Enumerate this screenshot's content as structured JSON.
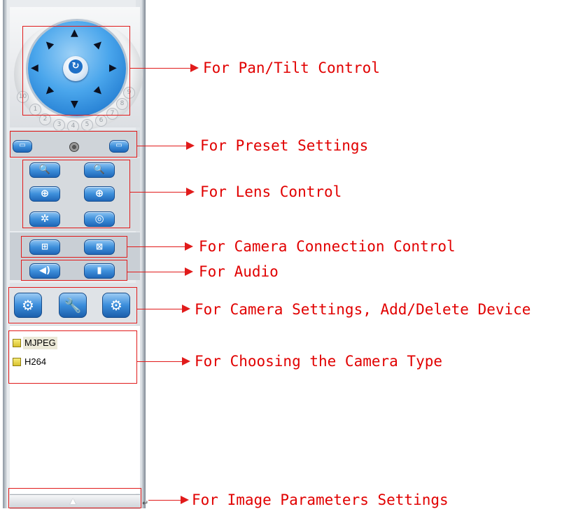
{
  "annotations": {
    "pan_tilt": "For Pan/Tilt Control",
    "preset": "For Preset Settings",
    "lens": "For Lens Control",
    "connection": "For Camera Connection Control",
    "audio": "For Audio",
    "camera_settings": "For Camera Settings, Add/Delete Device",
    "camera_type": "For Choosing the Camera Type",
    "image_params": "For Image Parameters Settings"
  },
  "ptz": {
    "center_icon": "rotate-icon",
    "arrows": [
      "up-arrow",
      "up-right-arrow",
      "right-arrow",
      "down-right-arrow",
      "down-arrow",
      "down-left-arrow",
      "left-arrow",
      "up-left-arrow"
    ],
    "preset_numbers": [
      "10",
      "1",
      "2",
      "3",
      "4",
      "5",
      "6",
      "7",
      "8",
      "9"
    ]
  },
  "camera_types": [
    {
      "label": "MJPEG",
      "selected": true
    },
    {
      "label": "H264",
      "selected": false
    }
  ],
  "colors": {
    "annotation_red": "#e10000",
    "button_blue": "#3d8fdb",
    "panel_grey": "#e9ecef"
  }
}
